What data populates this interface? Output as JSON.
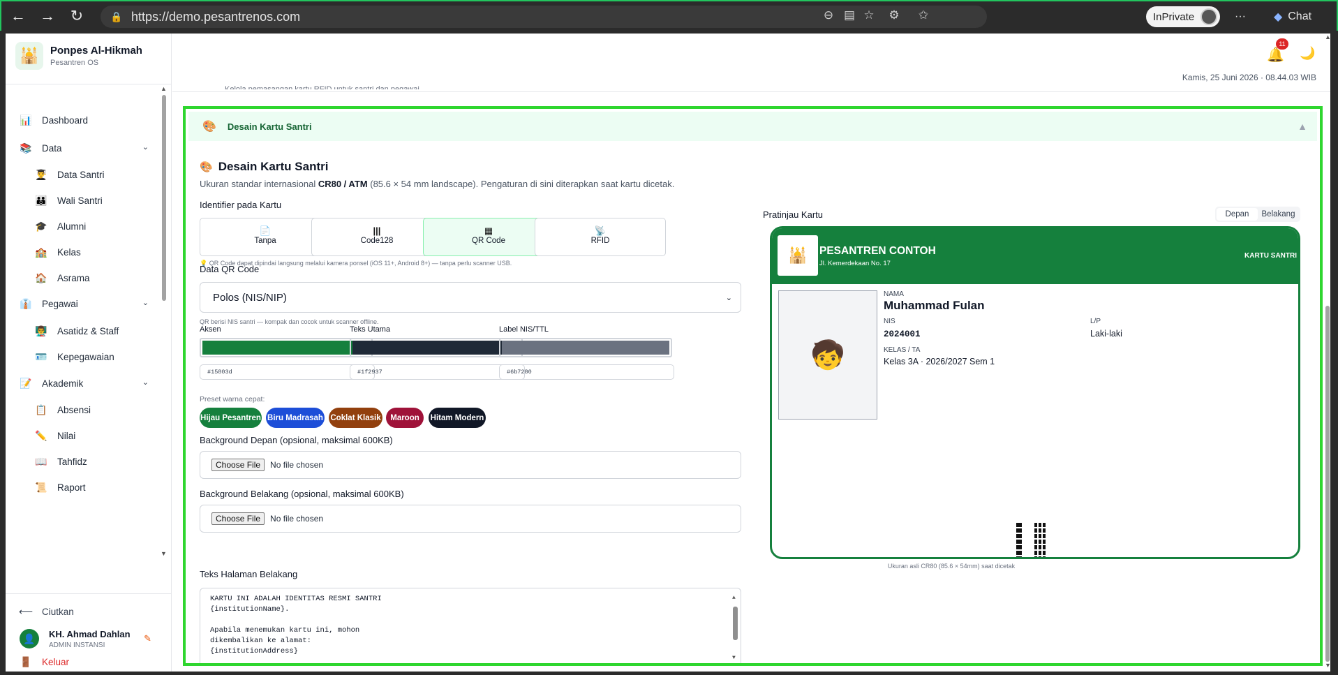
{
  "browser": {
    "url": "https://demo.pesantrenos.com",
    "inprivate": "InPrivate",
    "chat": "Chat"
  },
  "sidebar": {
    "brand_name": "Ponpes Al-Hikmah",
    "brand_sub": "Pesantren OS",
    "items": [
      {
        "label": "Dashboard"
      },
      {
        "label": "Data"
      },
      {
        "label": "Data Santri"
      },
      {
        "label": "Wali Santri"
      },
      {
        "label": "Alumni"
      },
      {
        "label": "Kelas"
      },
      {
        "label": "Asrama"
      },
      {
        "label": "Pegawai"
      },
      {
        "label": "Asatidz & Staff"
      },
      {
        "label": "Kepegawaian"
      },
      {
        "label": "Akademik"
      },
      {
        "label": "Absensi"
      },
      {
        "label": "Nilai"
      },
      {
        "label": "Tahfidz"
      },
      {
        "label": "Raport"
      }
    ],
    "collapse": "Ciutkan",
    "user_name": "KH. Ahmad Dahlan",
    "user_role": "ADMIN INSTANSI",
    "logout": "Keluar"
  },
  "header": {
    "notif_count": "11",
    "datetime": "Kamis, 25 Juni 2026 · 08.44.03 WIB",
    "partial_text": "Kelola pemasangan kartu RFID untuk santri dan pegawai."
  },
  "section": {
    "accordion_title": "Desain Kartu Santri",
    "title": "Desain Kartu Santri",
    "desc_pre": "Ukuran standar internasional ",
    "desc_bold": "CR80 / ATM",
    "desc_post": " (85.6 × 54 mm landscape). Pengaturan di sini diterapkan saat kartu dicetak.",
    "identifier_label": "Identifier pada Kartu",
    "identifiers": [
      {
        "label": "Tanpa"
      },
      {
        "label": "Code128"
      },
      {
        "label": "QR Code"
      },
      {
        "label": "RFID"
      }
    ],
    "identifier_hint": "💡 QR Code dapat dipindai langsung melalui kamera ponsel (iOS 11+, Android 8+) — tanpa perlu scanner USB.",
    "qr_label": "Data QR Code",
    "qr_value": "Polos (NIS/NIP)",
    "qr_hint": "QR berisi NIS santri — kompak dan cocok untuk scanner offline.",
    "colors": [
      {
        "label": "Aksen",
        "hex": "#15803d"
      },
      {
        "label": "Teks Utama",
        "hex": "#1f2937"
      },
      {
        "label": "Label NIS/TTL",
        "hex": "#6b7280"
      }
    ],
    "preset_label": "Preset warna cepat:",
    "presets": [
      {
        "label": "Hijau Pesantren",
        "color": "#15803d"
      },
      {
        "label": "Biru Madrasah",
        "color": "#1d4ed8"
      },
      {
        "label": "Coklat Klasik",
        "color": "#92400e"
      },
      {
        "label": "Maroon",
        "color": "#9f1239"
      },
      {
        "label": "Hitam Modern",
        "color": "#111827"
      }
    ],
    "bg_front_label": "Background Depan (opsional, maksimal 600KB)",
    "bg_back_label": "Background Belakang (opsional, maksimal 600KB)",
    "file_button": "Choose File",
    "file_none": "No file chosen",
    "back_text_label": "Teks Halaman Belakang",
    "back_text": "KARTU INI ADALAH IDENTITAS RESMI SANTRI\n{institutionName}.\n\nApabila menemukan kartu ini, mohon\ndikembalikan ke alamat:\n{institutionAddress}\n\nTelp: {institutionPhone}"
  },
  "preview": {
    "title": "Pratinjau Kartu",
    "tab_front": "Depan",
    "tab_back": "Belakang",
    "school": "PESANTREN CONTOH",
    "address": "Jl. Kemerdekaan No. 17",
    "tag": "KARTU SANTRI",
    "k_name": "NAMA",
    "name": "Muhammad Fulan",
    "k_nis": "NIS",
    "nis": "2024001",
    "k_lp": "L/P",
    "lp": "Laki-laki",
    "k_kelas": "KELAS / TA",
    "kelas": "Kelas 3A · 2026/2027 Sem 1",
    "caption": "Ukuran asli CR80 (85.6 × 54mm) saat dicetak"
  }
}
